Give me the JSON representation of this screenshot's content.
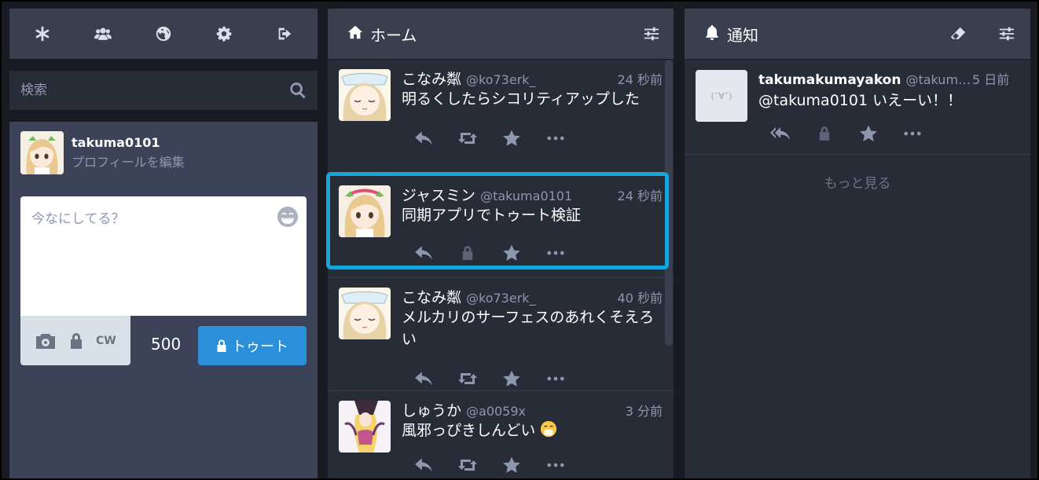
{
  "nav": {
    "icons": [
      "asterisk-icon",
      "users-icon",
      "globe-icon",
      "gear-icon",
      "sign-out-icon"
    ]
  },
  "search": {
    "placeholder": "検索"
  },
  "profile": {
    "username": "takuma0101",
    "edit_label": "プロフィールを編集"
  },
  "compose": {
    "placeholder": "今なにしてる？",
    "cw_label": "CW",
    "char_count": "500",
    "submit_label": "トゥート"
  },
  "home": {
    "title": "ホーム",
    "statuses": [
      {
        "display_name": "こなみ粼",
        "acct": "@ko73erk_",
        "time": "24 秒前",
        "text": "明るくしたらシコリティアップした",
        "privacy": "public"
      },
      {
        "display_name": "ジャスミン",
        "acct": "@takuma0101",
        "time": "24 秒前",
        "text": "同期アプリでトゥート検証",
        "privacy": "private"
      },
      {
        "display_name": "こなみ粼",
        "acct": "@ko73erk_",
        "time": "40 秒前",
        "text": "メルカリのサーフェスのあれくそえろい",
        "privacy": "public"
      },
      {
        "display_name": "しゅうか",
        "acct": "@a0059x",
        "time": "3 分前",
        "text": "風邪っぴきしんどい",
        "privacy": "public"
      }
    ]
  },
  "notifications": {
    "title": "通知",
    "items": [
      {
        "display_name": "takumakumayakon",
        "acct": "@takum…",
        "time": "5 日前",
        "text": "@takuma0101 いえーい！！",
        "avatar_text": "(ˇ∀ˇ)"
      }
    ],
    "load_more": "もっと見る"
  },
  "colors": {
    "accent": "#2b90d9",
    "highlight": "#17a5dd",
    "panel": "#282c37",
    "header": "#393f4f"
  }
}
